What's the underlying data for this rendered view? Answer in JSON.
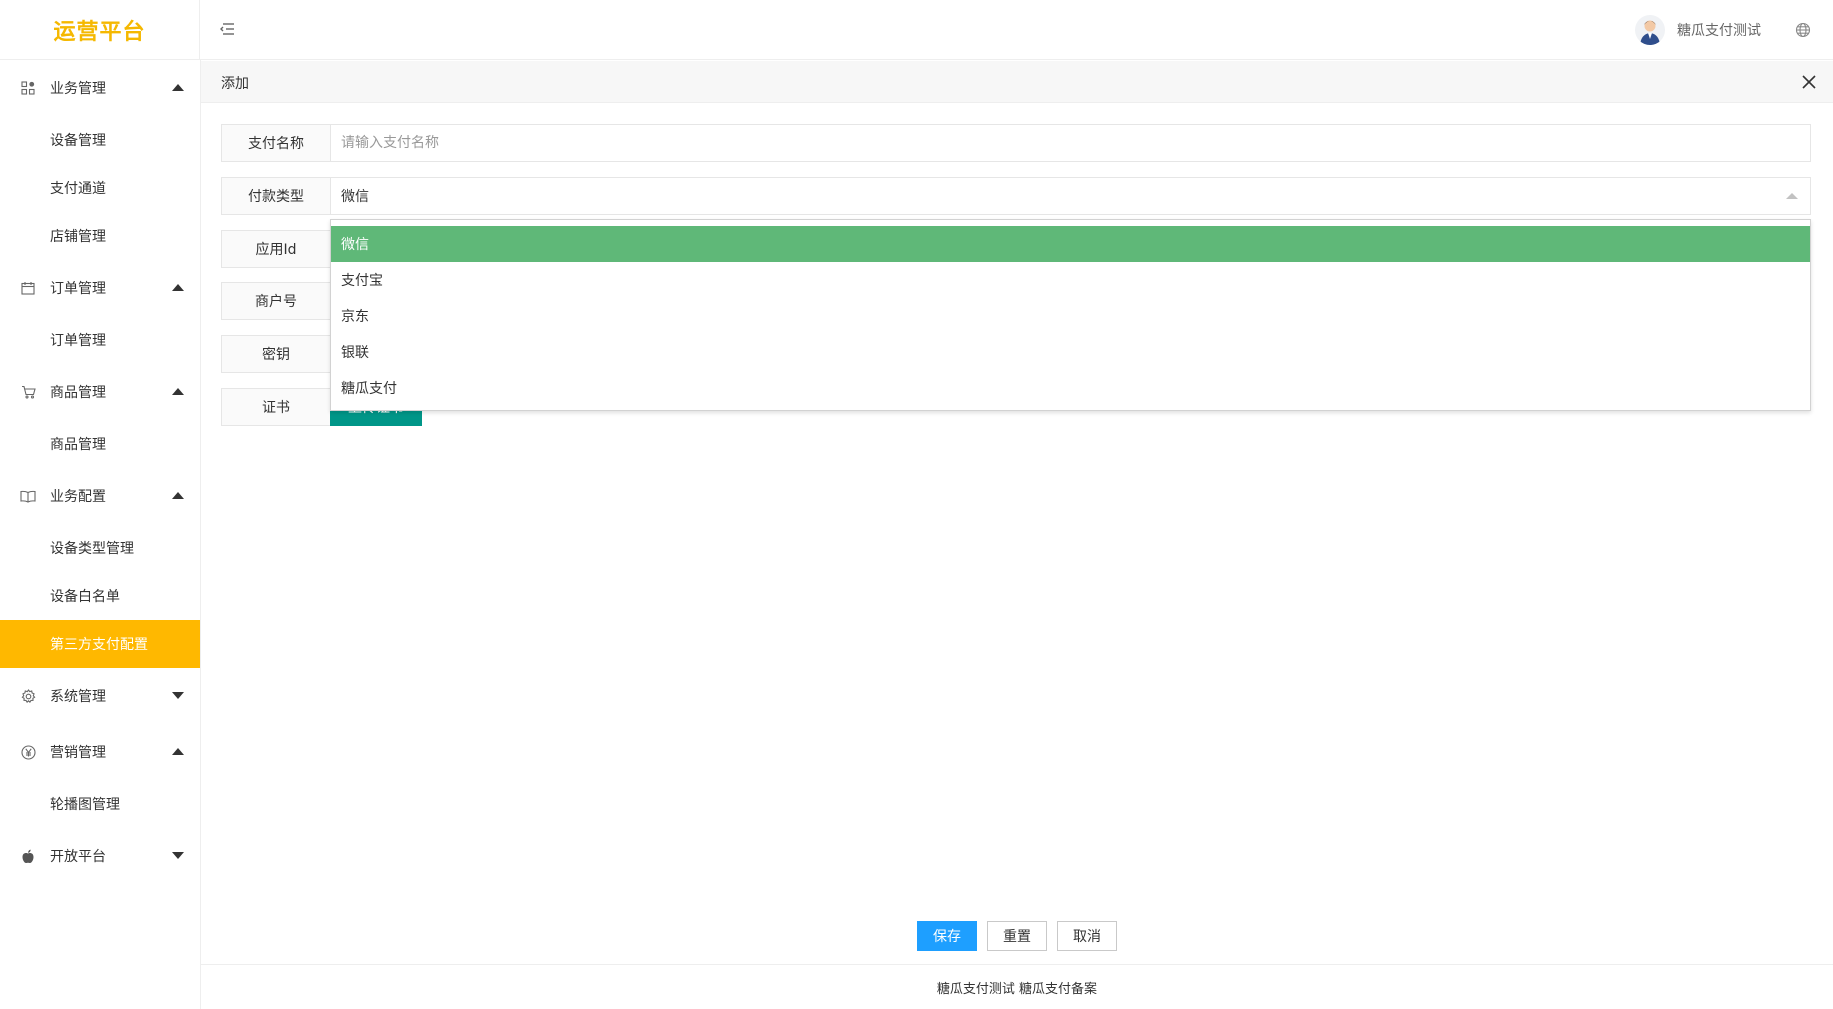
{
  "header": {
    "logo": "运营平台",
    "user_name": "糖瓜支付测试"
  },
  "sidebar": {
    "groups": [
      {
        "label": "业务管理",
        "icon": "apps-icon",
        "expanded": true,
        "items": [
          "设备管理",
          "支付通道",
          "店铺管理"
        ]
      },
      {
        "label": "订单管理",
        "icon": "calendar-icon",
        "expanded": true,
        "items": [
          "订单管理"
        ]
      },
      {
        "label": "商品管理",
        "icon": "cart-icon",
        "expanded": true,
        "items": [
          "商品管理"
        ]
      },
      {
        "label": "业务配置",
        "icon": "book-icon",
        "expanded": true,
        "items": [
          "设备类型管理",
          "设备白名单",
          "第三方支付配置"
        ]
      },
      {
        "label": "系统管理",
        "icon": "gear-icon",
        "expanded": false,
        "items": []
      },
      {
        "label": "营销管理",
        "icon": "yen-icon",
        "expanded": true,
        "items": [
          "轮播图管理"
        ]
      },
      {
        "label": "开放平台",
        "icon": "apple-icon",
        "expanded": false,
        "items": []
      }
    ],
    "active_item": "第三方支付配置"
  },
  "panel": {
    "title": "添加"
  },
  "form": {
    "pay_name": {
      "label": "支付名称",
      "placeholder": "请输入支付名称",
      "value": ""
    },
    "pay_type": {
      "label": "付款类型",
      "value": "微信",
      "options": [
        "微信",
        "支付宝",
        "京东",
        "银联",
        "糖瓜支付"
      ],
      "selected_index": 0
    },
    "app_id": {
      "label": "应用Id"
    },
    "merchant_no": {
      "label": "商户号"
    },
    "secret": {
      "label": "密钥"
    },
    "cert": {
      "label": "证书",
      "upload_label": "上传证书"
    }
  },
  "actions": {
    "save": "保存",
    "reset": "重置",
    "cancel": "取消"
  },
  "footer": {
    "text": "糖瓜支付测试 糖瓜支付备案"
  },
  "colors": {
    "logo": "#f5b800",
    "active_nav": "#ffb800",
    "dropdown_selected": "#5fb878",
    "primary_button": "#1e9fff",
    "upload_button": "#009688"
  }
}
